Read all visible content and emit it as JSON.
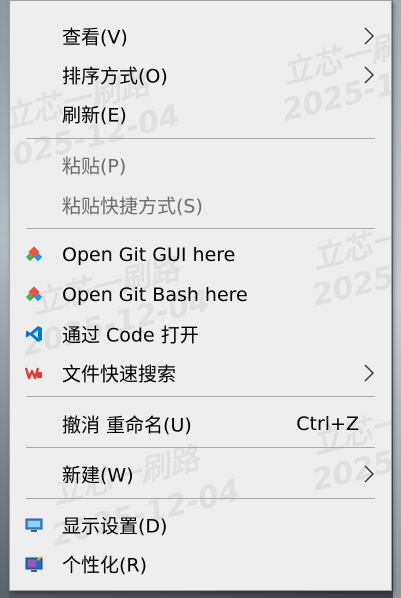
{
  "menu": {
    "items": [
      {
        "label": "查看(V)",
        "submenu": true,
        "disabled": false
      },
      {
        "label": "排序方式(O)",
        "submenu": true,
        "disabled": false
      },
      {
        "label": "刷新(E)",
        "submenu": false,
        "disabled": false
      },
      {
        "label": "粘贴(P)",
        "submenu": false,
        "disabled": true
      },
      {
        "label": "粘贴快捷方式(S)",
        "submenu": false,
        "disabled": true
      },
      {
        "label": "Open Git GUI here",
        "icon": "git-icon",
        "submenu": false,
        "disabled": false
      },
      {
        "label": "Open Git Bash here",
        "icon": "git-icon",
        "submenu": false,
        "disabled": false
      },
      {
        "label": "通过 Code 打开",
        "icon": "vscode-icon",
        "submenu": false,
        "disabled": false
      },
      {
        "label": "文件快速搜索",
        "icon": "wps-icon",
        "submenu": true,
        "disabled": false
      },
      {
        "label": "撤消 重命名(U)",
        "shortcut": "Ctrl+Z",
        "submenu": false,
        "disabled": false
      },
      {
        "label": "新建(W)",
        "submenu": true,
        "disabled": false
      },
      {
        "label": "显示设置(D)",
        "icon": "display-icon",
        "submenu": false,
        "disabled": false
      },
      {
        "label": "个性化(R)",
        "icon": "personalize-icon",
        "submenu": false,
        "disabled": false
      }
    ]
  },
  "watermark": {
    "name": "立芯一刷路",
    "date": "2025-12-04"
  },
  "colors": {
    "menu_bg": "#eeeeee",
    "disabled_text": "#6d6d6d",
    "separator": "#a9a9a9",
    "vscode_blue": "#0078d4",
    "wps_red": "#e53935"
  }
}
